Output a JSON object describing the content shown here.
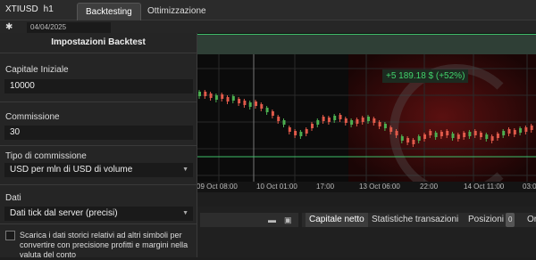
{
  "header": {
    "symbol": "XTIUSD",
    "timeframe": "h1",
    "tabs": [
      {
        "label": "Backtesting",
        "active": true
      },
      {
        "label": "Ottimizzazione",
        "active": false
      }
    ],
    "start_date": "04/04/2025"
  },
  "chart": {
    "pnl_label": "+5 189.18 $ (+52%)",
    "x_ticks": [
      "09 Oct 08:00",
      "10 Oct 01:00",
      "17:00",
      "13 Oct 06:00",
      "22:00",
      "14 Oct 11:00",
      "03:00"
    ]
  },
  "settings": {
    "title": "Impostazioni Backtest",
    "initial_capital_label": "Capitale Iniziale",
    "initial_capital": "10000",
    "commission_label": "Commissione",
    "commission": "30",
    "commission_type_label": "Tipo di commissione",
    "commission_type": "USD per mln di USD di volume",
    "data_label": "Dati",
    "data_source": "Dati tick dal server (precisi)",
    "download_text": "Scarica i dati storici relativi ad altri simboli per convertire con precisione profitti e margini nella valuta del conto",
    "download_checked": false
  },
  "bottom_tabs": [
    {
      "label": "Capitale netto",
      "active": true
    },
    {
      "label": "Statistiche transazioni",
      "active": false
    },
    {
      "label": "Posizioni",
      "badge": "0",
      "active": false
    },
    {
      "label": "Or",
      "active": false
    }
  ],
  "colors": {
    "accent_green": "#41d36b",
    "bull_candle": "#4caf50",
    "bear_candle": "#e05a4a",
    "background": "#0b0b0b"
  }
}
